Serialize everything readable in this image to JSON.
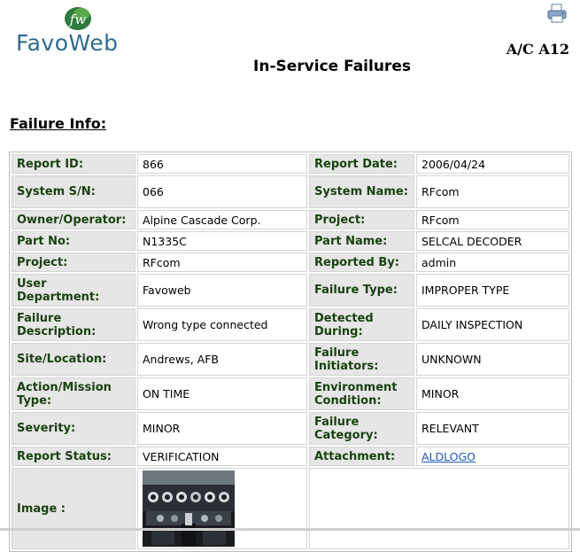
{
  "header": {
    "logo_text": "FavoWeb",
    "logo_monogram": "fw",
    "aircraft_label": "A/C A12",
    "title": "In-Service Failures",
    "printer_icon": "printer-icon"
  },
  "section": {
    "title": "Failure Info:"
  },
  "rows": [
    {
      "l1": "Report ID:",
      "v1": "866",
      "l2": "Report Date:",
      "v2": "2006/04/24"
    },
    {
      "l1": "System S/N:",
      "v1": "066",
      "l2": "System Name:",
      "v2": "RFcom"
    },
    {
      "l1": "Owner/Operator:",
      "v1": "Alpine Cascade Corp.",
      "l2": "Project:",
      "v2": "RFcom"
    },
    {
      "l1": "Part No:",
      "v1": "N1335C",
      "l2": "Part Name:",
      "v2": "SELCAL DECODER"
    },
    {
      "l1": "Project:",
      "v1": "RFcom",
      "l2": "Reported By:",
      "v2": "admin"
    },
    {
      "l1": "User Department:",
      "v1": "Favoweb",
      "l2": "Failure Type:",
      "v2": "IMPROPER TYPE"
    },
    {
      "l1": "Failure Description:",
      "v1": "Wrong type connected",
      "l2": "Detected During:",
      "v2": "DAILY INSPECTION"
    },
    {
      "l1": "Site/Location:",
      "v1": "Andrews, AFB",
      "l2": "Failure Initiators:",
      "v2": "UNKNOWN"
    },
    {
      "l1": "Action/Mission Type:",
      "v1": "ON TIME",
      "l2": "Environment Condition:",
      "v2": "MINOR"
    },
    {
      "l1": "Severity:",
      "v1": "MINOR",
      "l2": "Failure Category:",
      "v2": "RELEVANT"
    },
    {
      "l1": "Report Status:",
      "v1": "VERIFICATION",
      "l2": "Attachment:",
      "v2": "ALDLOGO"
    }
  ],
  "image_row": {
    "label": "Image :",
    "image_icon": "cockpit-photo"
  },
  "colors": {
    "label_bg": "#e6e6e6",
    "label_text": "#18420f",
    "link": "#1f57b8",
    "logo": "#2e6b8e"
  }
}
